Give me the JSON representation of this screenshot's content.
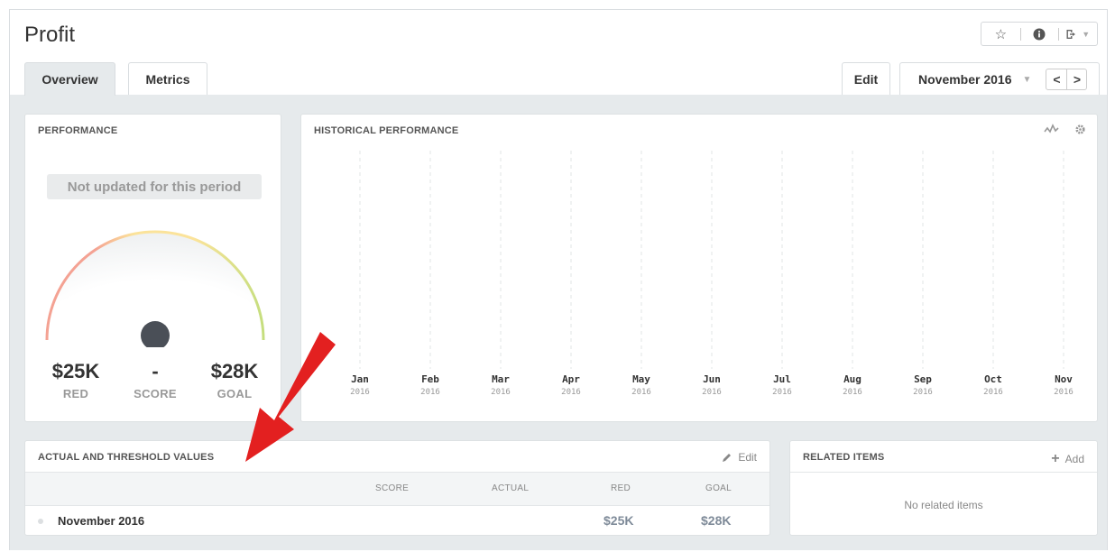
{
  "page": {
    "title": "Profit"
  },
  "toolbar": {
    "favorite_icon": "star-icon",
    "info_icon": "info-icon",
    "export_icon": "export-icon"
  },
  "tabs": [
    {
      "label": "Overview",
      "active": true
    },
    {
      "label": "Metrics",
      "active": false
    }
  ],
  "edit_tab": {
    "label": "Edit"
  },
  "period": {
    "label": "November 2016",
    "prev": "<",
    "next": ">"
  },
  "performance": {
    "title": "PERFORMANCE",
    "status": "Not updated for this period",
    "red_value": "$25K",
    "red_label": "RED",
    "score_value": "-",
    "score_label": "SCORE",
    "goal_value": "$28K",
    "goal_label": "GOAL",
    "colors": {
      "red": "#f4a293",
      "yellow": "#fbe39a",
      "green": "#c5de7e",
      "needle": "#4a4f57"
    }
  },
  "history": {
    "title": "HISTORICAL PERFORMANCE",
    "icons": [
      "sparkline-icon",
      "gear-icon"
    ]
  },
  "chart_data": {
    "type": "line",
    "title": "HISTORICAL PERFORMANCE",
    "categories": [
      "Jan",
      "Feb",
      "Mar",
      "Apr",
      "May",
      "Jun",
      "Jul",
      "Aug",
      "Sep",
      "Oct",
      "Nov"
    ],
    "category_years": [
      "2016",
      "2016",
      "2016",
      "2016",
      "2016",
      "2016",
      "2016",
      "2016",
      "2016",
      "2016",
      "2016"
    ],
    "series": [],
    "grid": "vertical-dashed"
  },
  "actual_values": {
    "title": "ACTUAL AND THRESHOLD VALUES",
    "edit_label": "Edit",
    "columns": [
      "SCORE",
      "ACTUAL",
      "RED",
      "GOAL"
    ],
    "rows": [
      {
        "label": "November 2016",
        "score": "",
        "actual": "",
        "red": "$25K",
        "goal": "$28K"
      }
    ]
  },
  "related": {
    "title": "RELATED ITEMS",
    "add_label": "Add",
    "empty": "No related items"
  },
  "annotation": {
    "arrow_color": "#e32020"
  }
}
